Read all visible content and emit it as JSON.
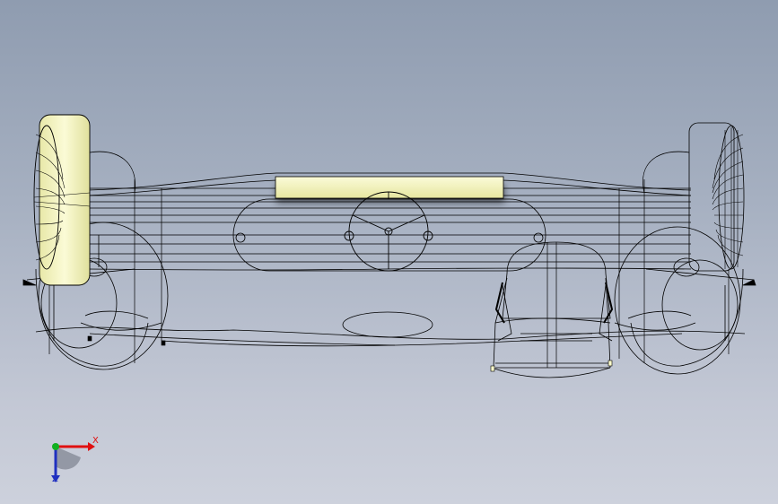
{
  "viewport": {
    "background_top": "#8f9cb0",
    "background_bottom": "#cdd1dc",
    "line_color": "#000000",
    "shaded_color": "#f2f2b4"
  },
  "triad": {
    "x_label": "X",
    "z_label": "Z",
    "x_color": "#e01010",
    "y_color": "#10b020",
    "z_color": "#2030c0"
  }
}
